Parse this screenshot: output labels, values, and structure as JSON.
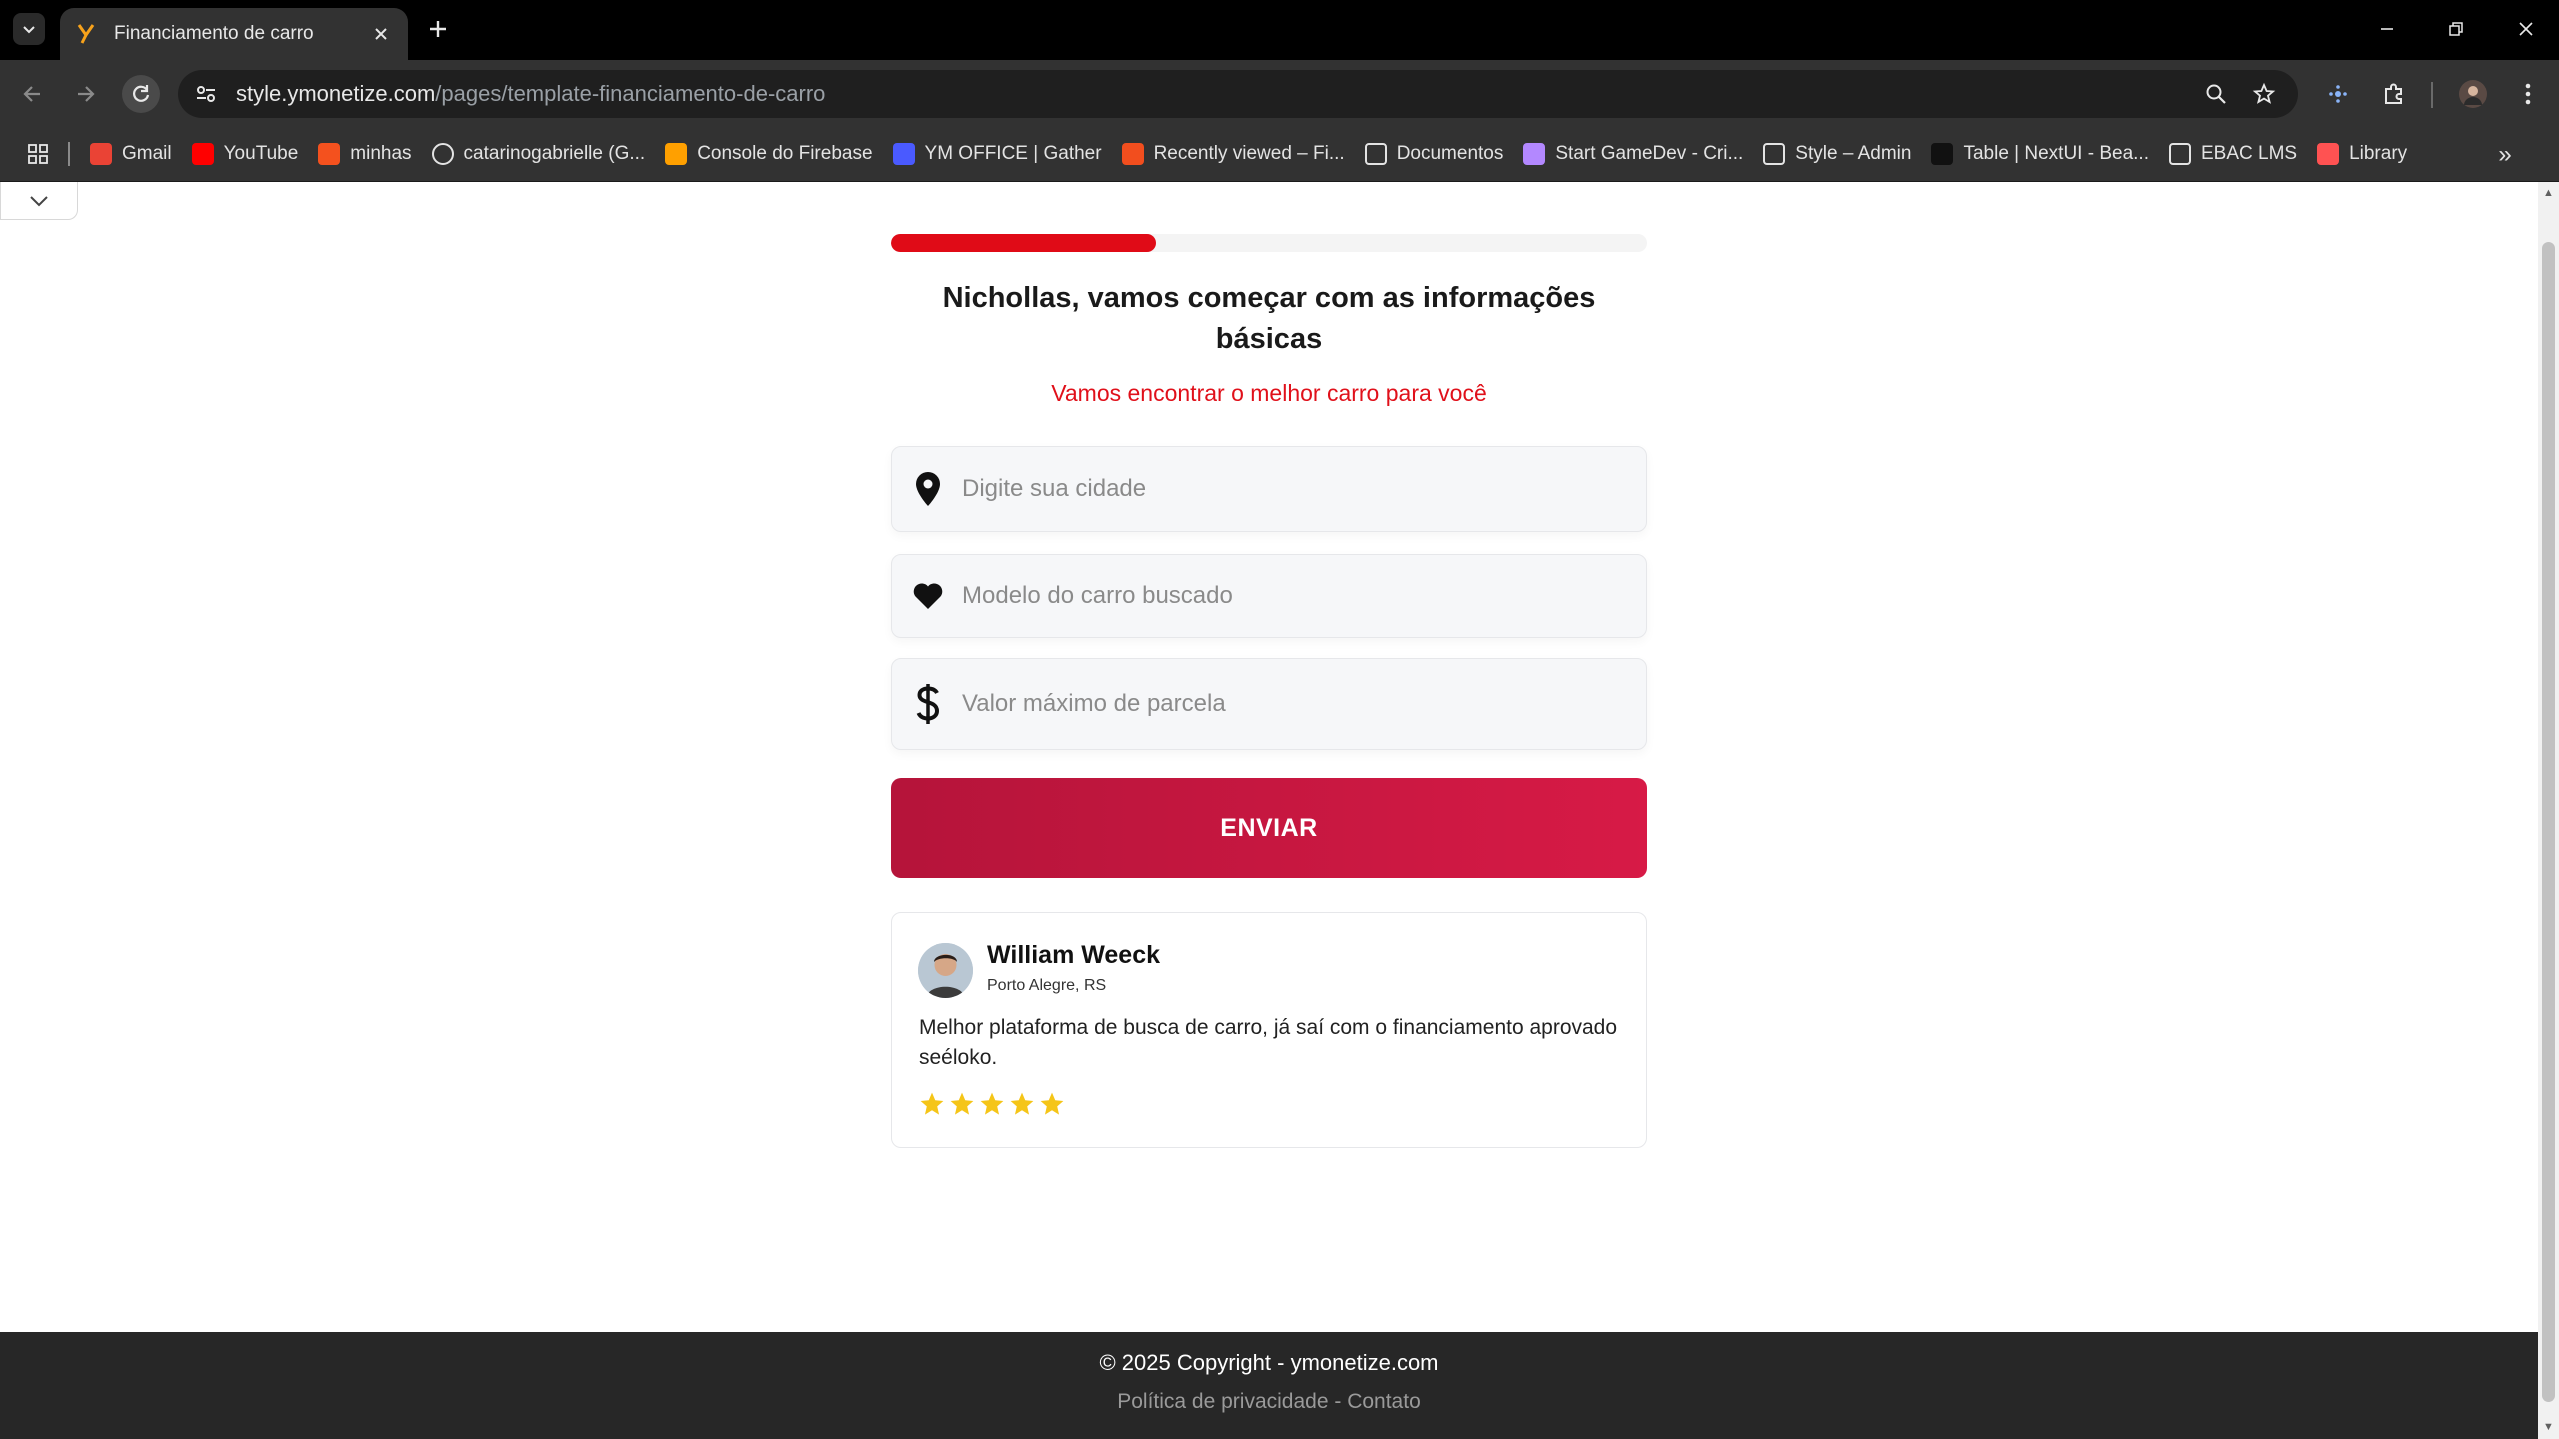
{
  "browser": {
    "tab_title": "Financiamento de carro",
    "url_domain": "style.ymonetize.com",
    "url_path": "/pages/template-financiamento-de-carro",
    "bookmarks": [
      {
        "label": "Gmail",
        "icon": "gmail-icon",
        "color": "#ea4335"
      },
      {
        "label": "YouTube",
        "icon": "youtube-icon",
        "color": "#ff0000"
      },
      {
        "label": "minhas",
        "icon": "fire-icon",
        "color": "#f4511e"
      },
      {
        "label": "catarinogabrielle (G...",
        "icon": "github-icon",
        "color": "#ffffff"
      },
      {
        "label": "Console do Firebase",
        "icon": "firebase-icon",
        "color": "#ffa000"
      },
      {
        "label": "YM OFFICE | Gather",
        "icon": "gather-icon",
        "color": "#4a5aff"
      },
      {
        "label": "Recently viewed – Fi...",
        "icon": "figma-icon",
        "color": "#f24e1e"
      },
      {
        "label": "Documentos",
        "icon": "docs-icon",
        "color": "#ffffff"
      },
      {
        "label": "Start GameDev - Cri...",
        "icon": "gamedev-icon",
        "color": "#b388ff"
      },
      {
        "label": "Style – Admin",
        "icon": "style-icon",
        "color": "#ffffff"
      },
      {
        "label": "Table | NextUI - Bea...",
        "icon": "nextui-icon",
        "color": "#111111"
      },
      {
        "label": "EBAC LMS",
        "icon": "ebac-icon",
        "color": "#ffffff"
      },
      {
        "label": "Library",
        "icon": "library-icon",
        "color": "#ff5252"
      }
    ]
  },
  "form": {
    "progress_fraction": 0.35,
    "headline": "Nichollas, vamos começar com as informações básicas",
    "subheadline": "Vamos encontrar o melhor carro para você",
    "city_placeholder": "Digite sua cidade",
    "model_placeholder": "Modelo do carro buscado",
    "installment_placeholder": "Valor máximo de parcela",
    "submit_label": "ENVIAR"
  },
  "review": {
    "name": "William Weeck",
    "city": "Porto Alegre, RS",
    "text": "Melhor plataforma de busca de carro, já saí com o financiamento aprovado seéloko.",
    "rating": 5
  },
  "footer": {
    "copyright": "© 2025 Copyright - ymonetize.com",
    "privacy": "Política de privacidade",
    "separator": " - ",
    "contact": "Contato"
  },
  "colors": {
    "accent": "#e00b17",
    "button_start": "#b5143a",
    "button_end": "#d71a46",
    "star": "#f5c518",
    "footer_bg": "#272727"
  }
}
